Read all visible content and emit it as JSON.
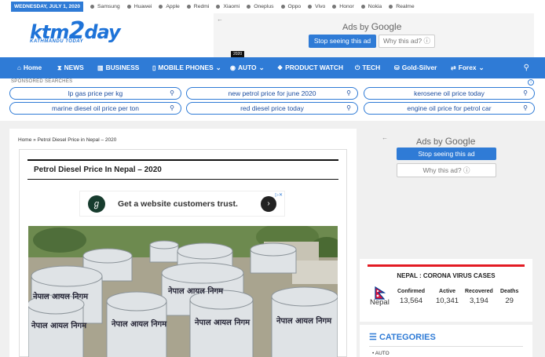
{
  "topbar": {
    "date": "WEDNESDAY, JULY 1, 2020",
    "brands": [
      "Samsung",
      "Huawei",
      "Apple",
      "Redmi",
      "Xiaomi",
      "Oneplus",
      "Oppo",
      "Vivo",
      "Honor",
      "Nokia",
      "Realme"
    ]
  },
  "logo": {
    "main_a": "ktm",
    "main_b": "2",
    "main_c": "day",
    "tagline": "KATHMANDU TODAY"
  },
  "top_ad": {
    "ads_by": "Ads by",
    "google": "Google",
    "stop": "Stop seeing this ad",
    "why": "Why this ad?"
  },
  "nav": {
    "badge": "2020",
    "items": [
      {
        "label": "Home",
        "icon": "home-icon"
      },
      {
        "label": "NEWS",
        "icon": "hourglass-icon"
      },
      {
        "label": "BUSINESS",
        "icon": "chart-icon"
      },
      {
        "label": "MOBILE PHONES",
        "icon": "phone-icon"
      },
      {
        "label": "AUTO",
        "icon": "car-icon"
      },
      {
        "label": "PRODUCT WATCH",
        "icon": "dropbox-icon"
      },
      {
        "label": "TECH",
        "icon": "power-icon"
      },
      {
        "label": "Gold-Silver",
        "icon": "coins-icon"
      },
      {
        "label": "Forex",
        "icon": "forex-icon"
      }
    ]
  },
  "sponsored": {
    "label": "SPONSORED SEARCHES",
    "pills": [
      "lp gas price per kg",
      "new petrol price for june 2020",
      "kerosene oil price today",
      "marine diesel oil price per ton",
      "red diesel price today",
      "engine oil price for petrol car"
    ]
  },
  "article": {
    "breadcrumb": "Home » Petrol Diesel Price in Nepal – 2020",
    "title": "Petrol Diesel Price In Nepal – 2020",
    "inner_ad": "Get a website customers trust.",
    "tank_text": "नेपाल आयल निगम"
  },
  "side_ad": {
    "ads_by": "Ads by",
    "google": "Google",
    "stop": "Stop seeing this ad",
    "why": "Why this ad?"
  },
  "covid": {
    "heading": "NEPAL : CORONA VIRUS CASES",
    "country": "Nepal",
    "columns": [
      {
        "label": "Confirmed",
        "value": "13,564"
      },
      {
        "label": "Active",
        "value": "10,341"
      },
      {
        "label": "Recovered",
        "value": "3,194"
      },
      {
        "label": "Deaths",
        "value": "29"
      }
    ]
  },
  "categories": {
    "heading": "CATEGORIES",
    "first": "AUTO"
  },
  "colors": {
    "accent": "#2f7bd6",
    "alert": "#e31b23"
  }
}
